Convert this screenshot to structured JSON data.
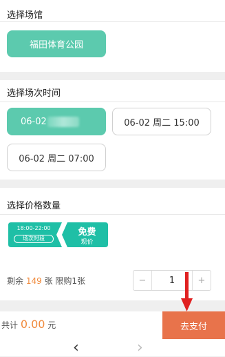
{
  "venue": {
    "title": "选择场馆",
    "selected": "福田体育公园"
  },
  "session_time": {
    "title": "选择场次时间",
    "options": [
      {
        "label": "06-02"
      },
      {
        "label": "06-02 周二 15:00"
      },
      {
        "label": "06-02 周二 07:00"
      }
    ]
  },
  "price": {
    "title": "选择价格数量",
    "ticket_time": "18:00-22:00",
    "ticket_time_caption": "场次时段",
    "ticket_price": "免费",
    "ticket_price_caption": "现价",
    "remaining_prefix": "剩余",
    "remaining_count": "149",
    "remaining_suffix": "张",
    "limit_text": "限购1张",
    "quantity": "1",
    "minus": "−",
    "plus": "+"
  },
  "footer": {
    "total_label": "共计",
    "total_amount": "0.00",
    "currency": "元",
    "pay_button": "去支付"
  },
  "nav": {
    "back": "‹",
    "forward": "›"
  },
  "colors": {
    "accent": "#5ccaae",
    "pay": "#e8734b",
    "highlight_number": "#f08a3c",
    "arrow": "#e02020"
  }
}
